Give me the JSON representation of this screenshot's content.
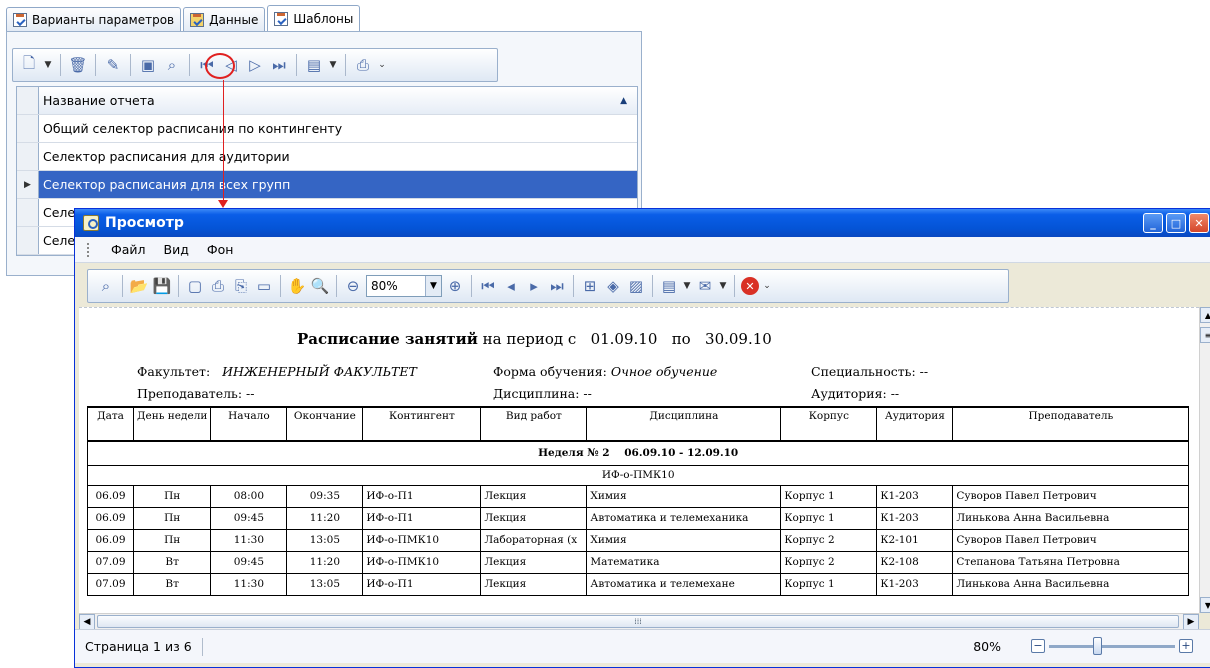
{
  "tabs": [
    {
      "label": "Варианты параметров",
      "icon": "checklist-icon"
    },
    {
      "label": "Данные",
      "icon": "data-icon"
    },
    {
      "label": "Шаблоны",
      "icon": "checklist-icon",
      "active": true
    }
  ],
  "grid": {
    "header": "Название отчета",
    "rows": [
      "Общий селектор расписания по контингенту",
      "Селектор расписания для аудитории",
      "Селектор расписания для всех групп",
      "Селе",
      "Селе"
    ],
    "selected_index": 2
  },
  "preview": {
    "title": "Просмотр",
    "menu": [
      "Файл",
      "Вид",
      "Фон"
    ],
    "zoom_value": "80%",
    "status_page": "Страница 1 из 6",
    "status_zoom": "80%"
  },
  "report": {
    "title_bold": "Расписание занятий",
    "title_rest": "на период с",
    "date_from": "01.09.10",
    "date_by": "по",
    "date_to": "30.09.10",
    "faculty_label": "Факультет:",
    "faculty_value": "ИНЖЕНЕРНЫЙ ФАКУЛЬТЕТ",
    "form_label": "Форма обучения:",
    "form_value": "Очное обучение",
    "specialty": "Специальность: --",
    "teacher": "Преподаватель: --",
    "discipline": "Дисциплина: --",
    "auditorium": "Аудитория: --",
    "columns": [
      "Дата",
      "День недели",
      "Начало",
      "Окончание",
      "Контингент",
      "Вид работ",
      "Дисциплина",
      "Корпус",
      "Аудитория",
      "Преподаватель"
    ],
    "week_label": "Неделя № 2",
    "week_range": "06.09.10 - 12.09.10",
    "group": "ИФ-о-ПМК10",
    "rows": [
      [
        "06.09",
        "Пн",
        "08:00",
        "09:35",
        "ИФ-о-П1",
        "Лекция",
        "Химия",
        "Корпус 1",
        "К1-203",
        "Суворов Павел Петрович"
      ],
      [
        "06.09",
        "Пн",
        "09:45",
        "11:20",
        "ИФ-о-П1",
        "Лекция",
        "Автоматика и телемеханика",
        "Корпус 1",
        "К1-203",
        "Линькова Анна Васильевна"
      ],
      [
        "06.09",
        "Пн",
        "11:30",
        "13:05",
        "ИФ-о-ПМК10",
        "Лабораторная (х",
        "Химия",
        "Корпус 2",
        "К2-101",
        "Суворов Павел Петрович"
      ],
      [
        "07.09",
        "Вт",
        "09:45",
        "11:20",
        "ИФ-о-ПМК10",
        "Лекция",
        "Математика",
        "Корпус 2",
        "К2-108",
        "Степанова Татьяна Петровна"
      ],
      [
        "07.09",
        "Вт",
        "11:30",
        "13:05",
        "ИФ-о-П1",
        "Лекция",
        "Автоматика и телемехане",
        "Корпус 1",
        "К1-203",
        "Линькова Анна Васильевна"
      ]
    ]
  },
  "colors": {
    "selection": "#3565c4",
    "title_bar": "#0a5ee8",
    "annotation": "#e02020"
  }
}
